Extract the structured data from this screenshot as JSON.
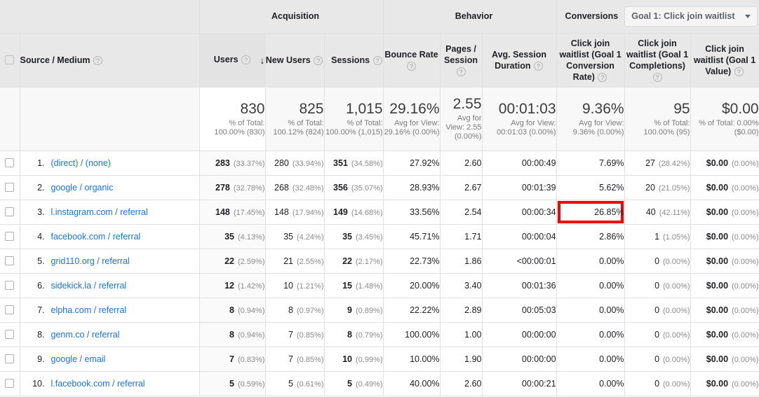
{
  "header": {
    "groups": [
      {
        "label": "Acquisition"
      },
      {
        "label": "Behavior"
      },
      {
        "label": "Conversions"
      }
    ],
    "goal_select": {
      "value": "Goal 1: Click join waitlist",
      "caret_icon": "chevron-down-icon"
    },
    "columns": {
      "source_medium": "Source / Medium",
      "users": "Users",
      "new_users": "New Users",
      "sessions": "Sessions",
      "bounce_rate": "Bounce Rate",
      "pages_session": "Pages / Session",
      "avg_duration": "Avg. Session Duration",
      "conv_rate": "Click join waitlist (Goal 1 Conversion Rate)",
      "completions": "Click join waitlist (Goal 1 Completions)",
      "goal_value": "Click join waitlist (Goal 1 Value)"
    },
    "help_icon": "?",
    "sort_icon": "↓"
  },
  "summary": [
    {
      "big": "830",
      "small": "% of Total: 100.00% (830)"
    },
    {
      "big": "825",
      "small": "% of Total: 100.12% (824)"
    },
    {
      "big": "1,015",
      "small": "% of Total: 100.00% (1,015)"
    },
    {
      "big": "29.16%",
      "small": "Avg for View: 29.16% (0.00%)"
    },
    {
      "big": "2.55",
      "small": "Avg for View: 2.55 (0.00%)"
    },
    {
      "big": "00:01:03",
      "small": "Avg for View: 00:01:03 (0.00%)"
    },
    {
      "big": "9.36%",
      "small": "Avg for View: 9.36% (0.00%)"
    },
    {
      "big": "95",
      "small": "% of Total: 100.00% (95)"
    },
    {
      "big": "$0.00",
      "small": "% of Total: 0.00% ($0.00)"
    }
  ],
  "rows": [
    {
      "index": "1.",
      "source": "(direct) / (none)",
      "users": "283",
      "users_pct": "(33.37%)",
      "new_users": "280",
      "new_users_pct": "(33.94%)",
      "sessions": "351",
      "sessions_pct": "(34.58%)",
      "bounce_rate": "27.92%",
      "pages_session": "2.60",
      "avg_duration": "00:00:49",
      "conv_rate": "7.69%",
      "completions": "27",
      "completions_pct": "(28.42%)",
      "goal_value": "$0.00",
      "goal_value_pct": "(0.00%)",
      "highlight": false
    },
    {
      "index": "2.",
      "source": "google / organic",
      "users": "278",
      "users_pct": "(32.78%)",
      "new_users": "268",
      "new_users_pct": "(32.48%)",
      "sessions": "356",
      "sessions_pct": "(35.07%)",
      "bounce_rate": "28.93%",
      "pages_session": "2.67",
      "avg_duration": "00:01:39",
      "conv_rate": "5.62%",
      "completions": "20",
      "completions_pct": "(21.05%)",
      "goal_value": "$0.00",
      "goal_value_pct": "(0.00%)",
      "highlight": false
    },
    {
      "index": "3.",
      "source": "l.instagram.com / referral",
      "users": "148",
      "users_pct": "(17.45%)",
      "new_users": "148",
      "new_users_pct": "(17.94%)",
      "sessions": "149",
      "sessions_pct": "(14.68%)",
      "bounce_rate": "33.56%",
      "pages_session": "2.54",
      "avg_duration": "00:00:34",
      "conv_rate": "26.85%",
      "completions": "40",
      "completions_pct": "(42.11%)",
      "goal_value": "$0.00",
      "goal_value_pct": "(0.00%)",
      "highlight": true
    },
    {
      "index": "4.",
      "source": "facebook.com / referral",
      "users": "35",
      "users_pct": "(4.13%)",
      "new_users": "35",
      "new_users_pct": "(4.24%)",
      "sessions": "35",
      "sessions_pct": "(3.45%)",
      "bounce_rate": "45.71%",
      "pages_session": "1.71",
      "avg_duration": "00:00:04",
      "conv_rate": "2.86%",
      "completions": "1",
      "completions_pct": "(1.05%)",
      "goal_value": "$0.00",
      "goal_value_pct": "(0.00%)",
      "highlight": false
    },
    {
      "index": "5.",
      "source": "grid110.org / referral",
      "users": "22",
      "users_pct": "(2.59%)",
      "new_users": "21",
      "new_users_pct": "(2.55%)",
      "sessions": "22",
      "sessions_pct": "(2.17%)",
      "bounce_rate": "22.73%",
      "pages_session": "1.86",
      "avg_duration": "<00:00:01",
      "conv_rate": "0.00%",
      "completions": "0",
      "completions_pct": "(0.00%)",
      "goal_value": "$0.00",
      "goal_value_pct": "(0.00%)",
      "highlight": false
    },
    {
      "index": "6.",
      "source": "sidekick.la / referral",
      "users": "12",
      "users_pct": "(1.42%)",
      "new_users": "10",
      "new_users_pct": "(1.21%)",
      "sessions": "15",
      "sessions_pct": "(1.48%)",
      "bounce_rate": "20.00%",
      "pages_session": "3.40",
      "avg_duration": "00:01:36",
      "conv_rate": "0.00%",
      "completions": "0",
      "completions_pct": "(0.00%)",
      "goal_value": "$0.00",
      "goal_value_pct": "(0.00%)",
      "highlight": false
    },
    {
      "index": "7.",
      "source": "elpha.com / referral",
      "users": "8",
      "users_pct": "(0.94%)",
      "new_users": "8",
      "new_users_pct": "(0.97%)",
      "sessions": "9",
      "sessions_pct": "(0.89%)",
      "bounce_rate": "22.22%",
      "pages_session": "2.89",
      "avg_duration": "00:05:03",
      "conv_rate": "0.00%",
      "completions": "0",
      "completions_pct": "(0.00%)",
      "goal_value": "$0.00",
      "goal_value_pct": "(0.00%)",
      "highlight": false
    },
    {
      "index": "8.",
      "source": "genm.co / referral",
      "users": "8",
      "users_pct": "(0.94%)",
      "new_users": "7",
      "new_users_pct": "(0.85%)",
      "sessions": "8",
      "sessions_pct": "(0.79%)",
      "bounce_rate": "100.00%",
      "pages_session": "1.00",
      "avg_duration": "00:00:00",
      "conv_rate": "0.00%",
      "completions": "0",
      "completions_pct": "(0.00%)",
      "goal_value": "$0.00",
      "goal_value_pct": "(0.00%)",
      "highlight": false
    },
    {
      "index": "9.",
      "source": "google / email",
      "users": "7",
      "users_pct": "(0.83%)",
      "new_users": "7",
      "new_users_pct": "(0.85%)",
      "sessions": "10",
      "sessions_pct": "(0.99%)",
      "bounce_rate": "10.00%",
      "pages_session": "1.90",
      "avg_duration": "00:00:00",
      "conv_rate": "0.00%",
      "completions": "0",
      "completions_pct": "(0.00%)",
      "goal_value": "$0.00",
      "goal_value_pct": "(0.00%)",
      "highlight": false
    },
    {
      "index": "10.",
      "source": "l.facebook.com / referral",
      "users": "5",
      "users_pct": "(0.59%)",
      "new_users": "5",
      "new_users_pct": "(0.61%)",
      "sessions": "5",
      "sessions_pct": "(0.49%)",
      "bounce_rate": "40.00%",
      "pages_session": "2.60",
      "avg_duration": "00:00:21",
      "conv_rate": "0.00%",
      "completions": "0",
      "completions_pct": "(0.00%)",
      "goal_value": "$0.00",
      "goal_value_pct": "(0.00%)",
      "highlight": false
    }
  ],
  "colors": {
    "link": "#1a73e8",
    "highlight": "#ff0000",
    "header_bg": "#e8e8e8"
  }
}
